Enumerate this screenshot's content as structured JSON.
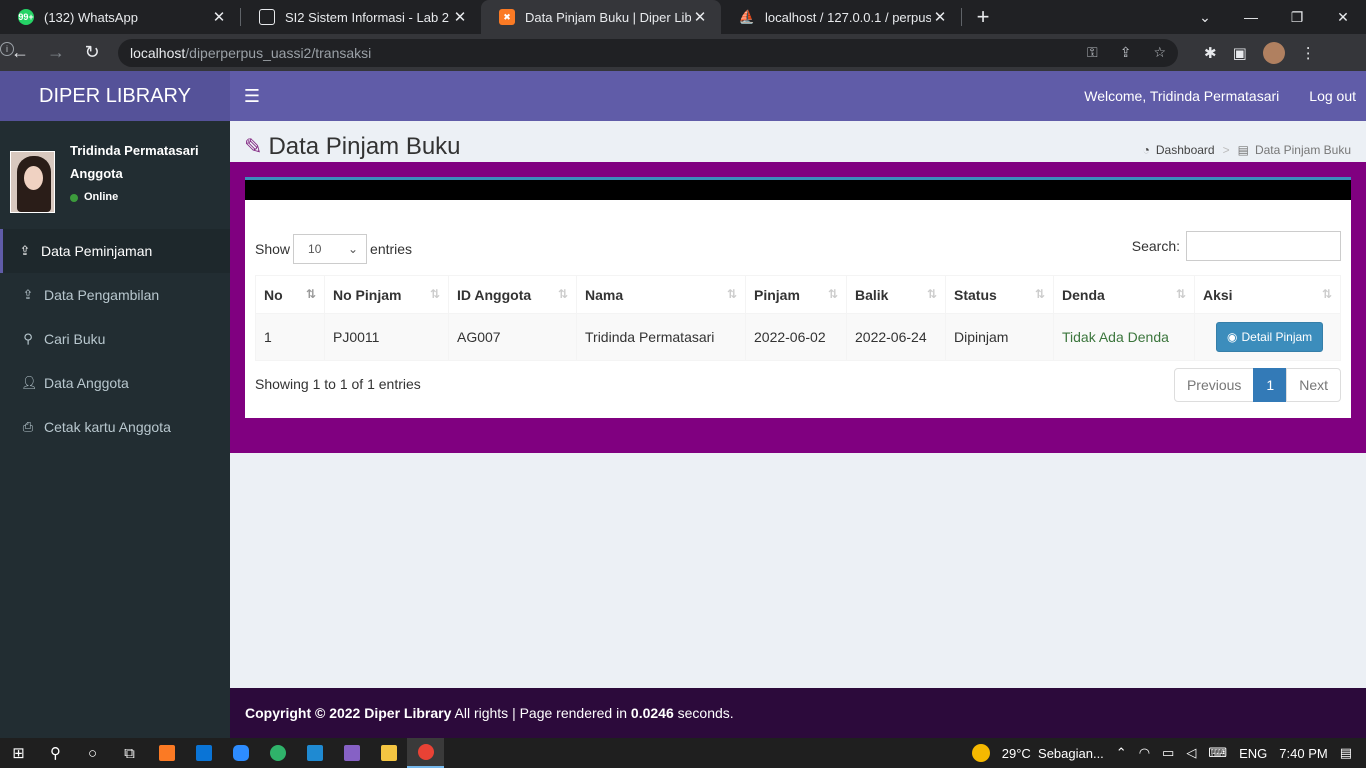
{
  "browser": {
    "tabs": [
      {
        "title": "(132) WhatsApp",
        "favicon": "whatsapp-icon",
        "color": "#25d366",
        "badge": "99+"
      },
      {
        "title": "SI2 Sistem Informasi - Lab 2",
        "favicon": "classroom-icon",
        "color": "#e8eaed"
      },
      {
        "title": "Data Pinjam Buku | Diper Library",
        "favicon": "xampp-icon",
        "color": "#fb7a24",
        "active": true
      },
      {
        "title": "localhost / 127.0.0.1 / perpus_si2",
        "favicon": "phpmyadmin-icon",
        "color": "#f0a030"
      }
    ],
    "url_host": "localhost",
    "url_path": "/diperperpus_uassi2/transaksi"
  },
  "app": {
    "logo": "DIPER LIBRARY",
    "welcome": "Welcome, Tridinda Permatasari",
    "logout": "Log out"
  },
  "user": {
    "name": "Tridinda Permatasari",
    "role": "Anggota",
    "status": "Online"
  },
  "sidebar": {
    "items": [
      {
        "label": "Data Peminjaman",
        "icon": "upload-icon",
        "active": true
      },
      {
        "label": "Data Pengambilan",
        "icon": "upload-icon"
      },
      {
        "label": "Cari Buku",
        "icon": "search-icon"
      },
      {
        "label": "Data Anggota",
        "icon": "user-icon"
      },
      {
        "label": "Cetak kartu Anggota",
        "icon": "print-icon"
      }
    ]
  },
  "page": {
    "title": "Data Pinjam Buku",
    "breadcrumb": [
      "Dashboard",
      "Data Pinjam Buku"
    ]
  },
  "table": {
    "show_label": "Show",
    "entries_label": "entries",
    "page_size": "10",
    "search_label": "Search:",
    "columns": [
      "No",
      "No Pinjam",
      "ID Anggota",
      "Nama",
      "Pinjam",
      "Balik",
      "Status",
      "Denda",
      "Aksi"
    ],
    "rows": [
      {
        "no": "1",
        "no_pinjam": "PJ0011",
        "id_anggota": "AG007",
        "nama": "Tridinda Permatasari",
        "pinjam": "2022-06-02",
        "balik": "2022-06-24",
        "status": "Dipinjam",
        "denda": "Tidak Ada Denda",
        "aksi": "Detail Pinjam"
      }
    ],
    "info": "Showing 1 to 1 of 1 entries",
    "previous": "Previous",
    "current_page": "1",
    "next": "Next"
  },
  "footer": {
    "copyright": "Copyright © 2022 Diper Library",
    "rights": " All rights | Page rendered in ",
    "time": "0.0246",
    "seconds": " seconds."
  },
  "taskbar": {
    "weather": "29°C  Sebagian...",
    "lang": "ENG",
    "time": "7:40 PM"
  },
  "colors": {
    "header": "#605ca8",
    "logo": "#555299",
    "content_bg": "#800080",
    "footer": "#2c0a3b",
    "sidebar": "#222d32"
  }
}
